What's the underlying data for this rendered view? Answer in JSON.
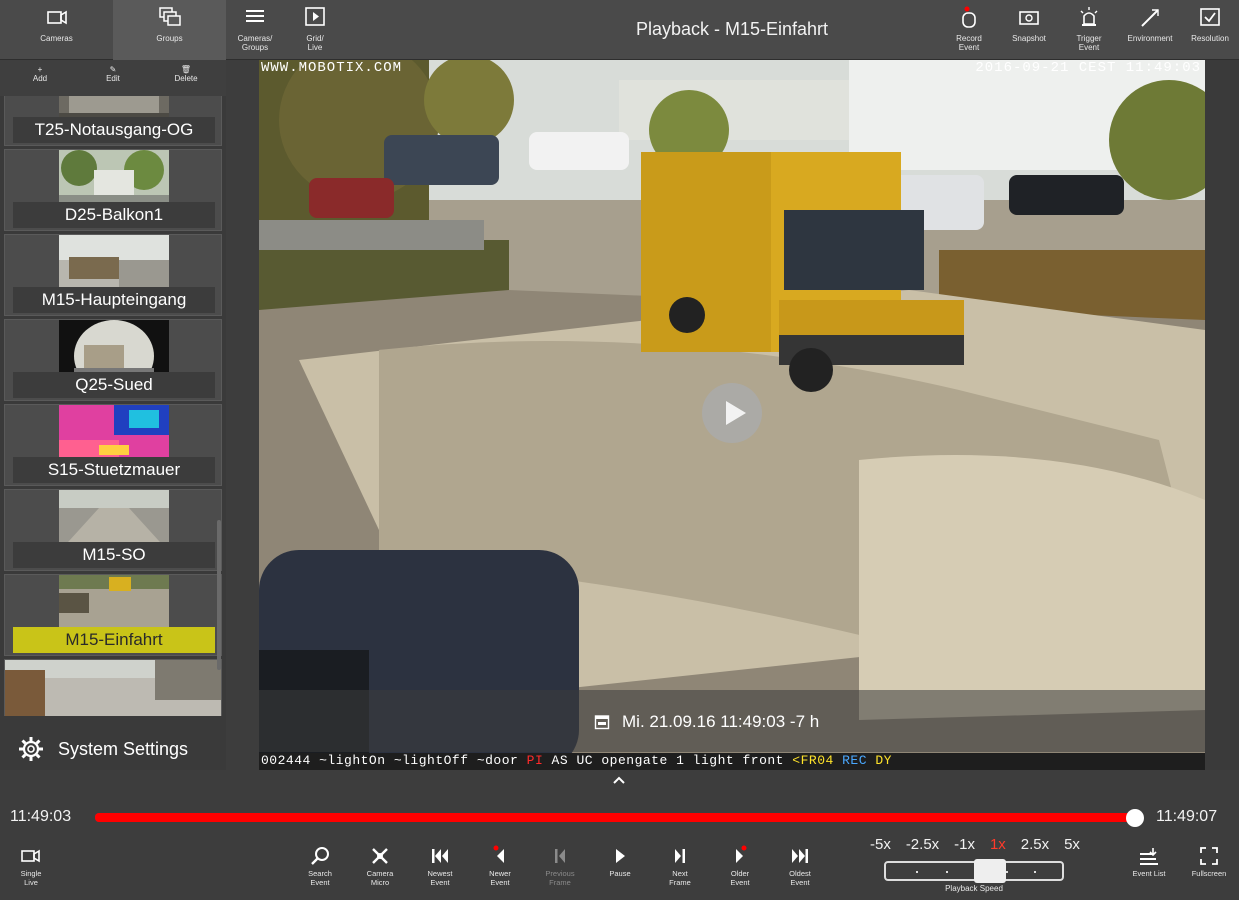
{
  "window": {
    "title": "Playback - M15-Einfahrt"
  },
  "topbar": {
    "left_buttons": [
      {
        "label": "Cameras",
        "icon": "camera-icon"
      },
      {
        "label": "Groups",
        "icon": "groups-icon",
        "active": true
      },
      {
        "label": "Cameras/\nGroups",
        "icon": "list-icon"
      },
      {
        "label": "Grid/\nLive",
        "icon": "grid-live-icon"
      }
    ],
    "right_buttons": [
      {
        "label": "Record\nEvent",
        "icon": "record-event-icon"
      },
      {
        "label": "Snapshot",
        "icon": "snapshot-icon"
      },
      {
        "label": "Trigger\nEvent",
        "icon": "trigger-event-icon"
      },
      {
        "label": "Environment",
        "icon": "environment-icon"
      },
      {
        "label": "Resolution",
        "icon": "resolution-icon"
      }
    ]
  },
  "sidebar": {
    "tools": [
      {
        "label": "Add",
        "icon": "+"
      },
      {
        "label": "Edit",
        "icon": "✎"
      },
      {
        "label": "Delete",
        "icon": "🗑"
      }
    ],
    "cameras": [
      {
        "name": "T25-Notausgang-OG",
        "selected": false
      },
      {
        "name": "D25-Balkon1",
        "selected": false
      },
      {
        "name": "M15-Haupteingang",
        "selected": false
      },
      {
        "name": "Q25-Sued",
        "selected": false
      },
      {
        "name": "S15-Stuetzmauer",
        "selected": false
      },
      {
        "name": "M15-SO",
        "selected": false
      },
      {
        "name": "M15-Einfahrt",
        "selected": true
      },
      {
        "name": "",
        "selected": false
      }
    ],
    "settings_label": "System Settings"
  },
  "video": {
    "osd_top_left": "WWW.MOBOTIX.COM",
    "osd_top_right": "2016-09-21 CEST 11:49:03",
    "osd_bottom": {
      "part1": "002444 ~lightOn ~lightOff ~door ",
      "pi": "PI",
      "part2": " AS UC opengate 1 light front ",
      "fr": "<FR04",
      "rec": " REC",
      "dy": " DY"
    },
    "timestamp": "Mi. 21.09.16 11:49:03 -7 h"
  },
  "timeline": {
    "start": "11:49:03",
    "end": "11:49:07",
    "progress": 1.0
  },
  "controls": [
    {
      "label": "Single\nLive",
      "icon": "single-live-icon",
      "disabled": false
    },
    {
      "label": "Search\nEvent",
      "icon": "search-event-icon",
      "disabled": false
    },
    {
      "label": "Camera\nMicro",
      "icon": "camera-micro-icon",
      "disabled": false
    },
    {
      "label": "Newest\nEvent",
      "icon": "newest-event-icon",
      "disabled": false
    },
    {
      "label": "Newer\nEvent",
      "icon": "newer-event-icon",
      "disabled": false
    },
    {
      "label": "Previous\nFrame",
      "icon": "previous-frame-icon",
      "disabled": true
    },
    {
      "label": "Pause",
      "icon": "pause-icon",
      "disabled": false
    },
    {
      "label": "Next\nFrame",
      "icon": "next-frame-icon",
      "disabled": false
    },
    {
      "label": "Older\nEvent",
      "icon": "older-event-icon",
      "disabled": false
    },
    {
      "label": "Oldest\nEvent",
      "icon": "oldest-event-icon",
      "disabled": false
    },
    {
      "label": "Event List",
      "icon": "event-list-icon",
      "disabled": false
    },
    {
      "label": "Fullscreen",
      "icon": "fullscreen-icon",
      "disabled": false
    }
  ],
  "playback_speed": {
    "options": [
      "-5x",
      "-2.5x",
      "-1x",
      "1x",
      "2.5x",
      "5x"
    ],
    "selected": "1x",
    "label": "Playback Speed"
  },
  "colors": {
    "accent_red": "#ff0000",
    "selected_yellow": "#c9c418",
    "background": "#3d3d3d"
  }
}
